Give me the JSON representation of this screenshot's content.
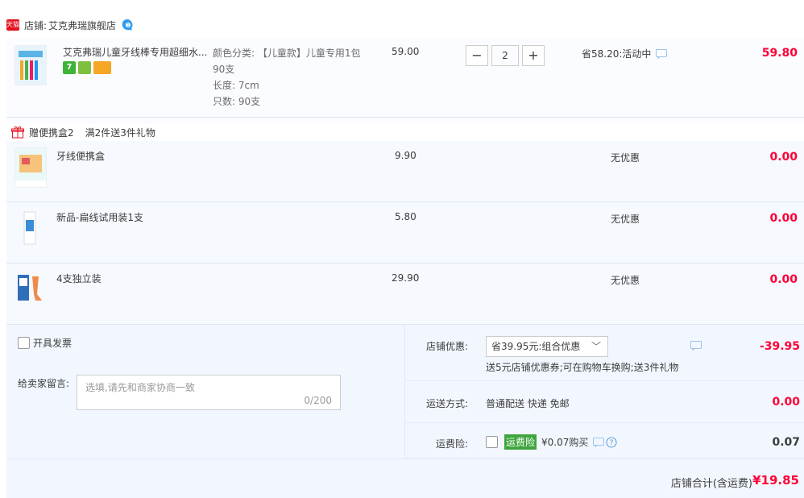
{
  "shop": {
    "badge": "天猫",
    "label": "店铺:",
    "name": "艾克弗瑞旗舰店"
  },
  "main_item": {
    "title": "艾克弗瑞儿童牙线棒专用超细水...",
    "specs": [
      "颜色分类: 【儿童款】儿童专用1包90支",
      "长度: 7cm",
      "只数: 90支"
    ],
    "price": "59.00",
    "quantity": "2",
    "promo": "省58.20:活动中",
    "subtotal": "59.80"
  },
  "gift": {
    "title": "赠便携盒2",
    "rule": "满2件送3件礼物",
    "items": [
      {
        "name": "牙线便携盒",
        "price": "9.90",
        "promo": "无优惠",
        "subtotal": "0.00"
      },
      {
        "name": "新品-扁线试用装1支",
        "price": "5.80",
        "promo": "无优惠",
        "subtotal": "0.00"
      },
      {
        "name": "4支独立装",
        "price": "29.90",
        "promo": "无优惠",
        "subtotal": "0.00"
      }
    ]
  },
  "invoice": {
    "label": "开具发票"
  },
  "note": {
    "label": "给卖家留言:",
    "placeholder": "选填,请先和商家协商一致",
    "count": "0/200"
  },
  "shop_discount": {
    "label": "店铺优惠:",
    "selected": "省39.95元:组合优惠",
    "detail": "送5元店铺优惠券;可在购物车换购;送3件礼物",
    "value": "-39.95"
  },
  "shipping": {
    "label": "运送方式:",
    "method": "普通配送 快递 免邮",
    "value": "0.00"
  },
  "insurance": {
    "label": "运费险:",
    "tag": "运费险",
    "price_text": "¥0.07购买",
    "value": "0.07"
  },
  "total": {
    "label": "店铺合计(含运费)",
    "value": "¥19.85"
  },
  "colors": {
    "accent_red": "#ff0036",
    "tmall_red": "#e5101e",
    "insurance_green": "#3fa63f"
  }
}
